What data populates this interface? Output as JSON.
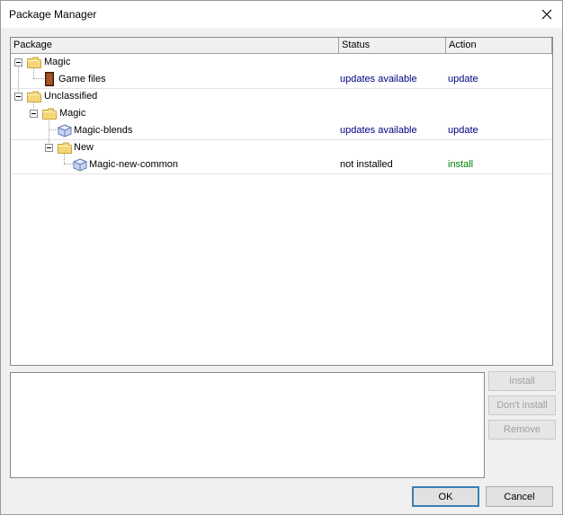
{
  "window": {
    "title": "Package Manager"
  },
  "columns": {
    "package": "Package",
    "status": "Status",
    "action": "Action"
  },
  "tree": [
    {
      "label": "Magic",
      "icon": "folder-icon",
      "status": "",
      "action": "",
      "action_color": ""
    },
    {
      "label": "Game files",
      "icon": "game-files-icon",
      "status": "updates available",
      "action": "update",
      "action_color": "#000080"
    },
    {
      "label": "Unclassified",
      "icon": "folder-icon",
      "status": "",
      "action": "",
      "action_color": ""
    },
    {
      "label": "Magic",
      "icon": "folder-icon",
      "status": "",
      "action": "",
      "action_color": ""
    },
    {
      "label": "Magic-blends",
      "icon": "package-icon",
      "status": "updates available",
      "action": "update",
      "action_color": "#000080"
    },
    {
      "label": "New",
      "icon": "folder-icon",
      "status": "",
      "action": "",
      "action_color": ""
    },
    {
      "label": "Magic-new-common",
      "icon": "package-icon",
      "status": "not installed",
      "action": "install",
      "action_color": "#008000"
    }
  ],
  "buttons": {
    "install": "Install",
    "dont_install": "Don't install",
    "remove": "Remove",
    "ok": "OK",
    "cancel": "Cancel"
  },
  "colors": {
    "status_blue": "#000080",
    "action_green": "#008000",
    "folder_yellow": "#f5d77a"
  }
}
